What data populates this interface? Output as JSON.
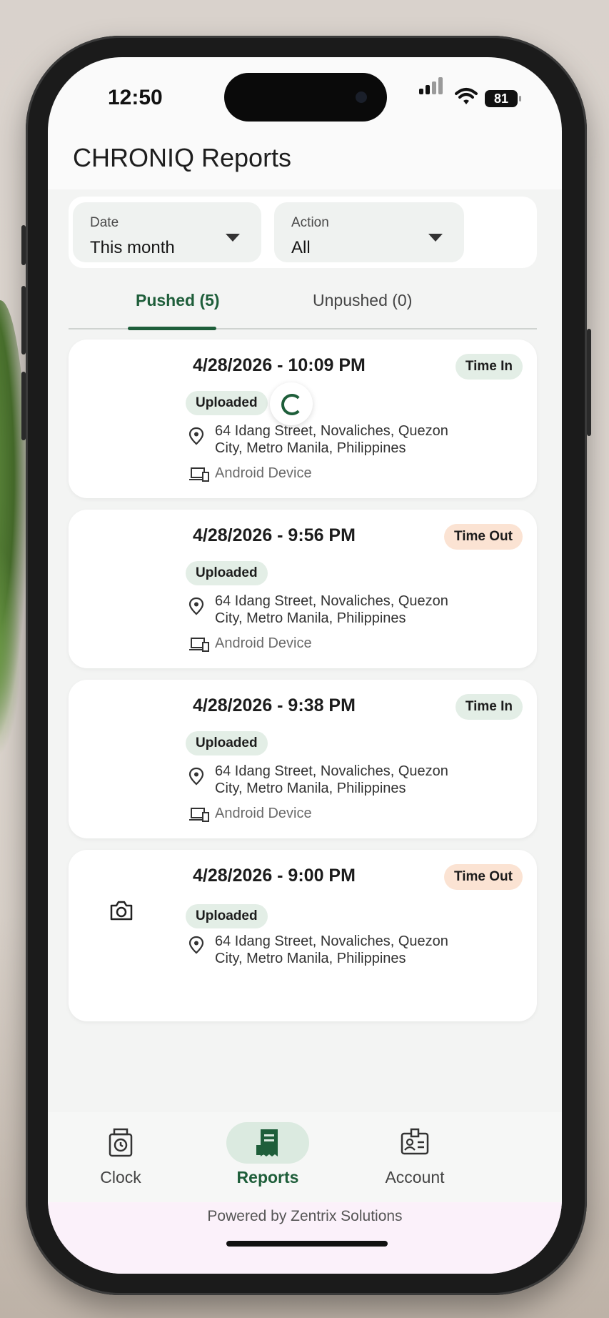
{
  "status_bar": {
    "time": "12:50",
    "battery": "81"
  },
  "app": {
    "title": "CHRONIQ Reports"
  },
  "filters": {
    "date": {
      "label": "Date",
      "value": "This month"
    },
    "action": {
      "label": "Action",
      "value": "All"
    }
  },
  "tabs": [
    {
      "label": "Pushed (5)",
      "active": true
    },
    {
      "label": "Unpushed (0)",
      "active": false
    }
  ],
  "records": [
    {
      "datetime": "4/28/2026 - 10:09 PM",
      "action": "Time In",
      "status": "Uploaded",
      "address": "64 Idang Street, Novaliches, Quezon City, Metro Manila, Philippines",
      "device": "Android Device"
    },
    {
      "datetime": "4/28/2026 - 9:56 PM",
      "action": "Time Out",
      "status": "Uploaded",
      "address": "64 Idang Street, Novaliches, Quezon City, Metro Manila, Philippines",
      "device": "Android Device"
    },
    {
      "datetime": "4/28/2026 - 9:38 PM",
      "action": "Time In",
      "status": "Uploaded",
      "address": "64 Idang Street, Novaliches, Quezon City, Metro Manila, Philippines",
      "device": "Android Device"
    },
    {
      "datetime": "4/28/2026 - 9:00 PM",
      "action": "Time Out",
      "status": "Uploaded",
      "address": "64 Idang Street, Novaliches, Quezon City, Metro Manila, Philippines",
      "device": ""
    }
  ],
  "nav": [
    {
      "label": "Clock",
      "icon": "clock-icon"
    },
    {
      "label": "Reports",
      "icon": "receipt-icon",
      "active": true
    },
    {
      "label": "Account",
      "icon": "badge-icon"
    }
  ],
  "footer": {
    "text": "Powered by Zentrix Solutions"
  },
  "colors": {
    "accent": "#1e5e3a",
    "time_in_bg": "#e3eee6",
    "time_out_bg": "#fbe3d3"
  }
}
